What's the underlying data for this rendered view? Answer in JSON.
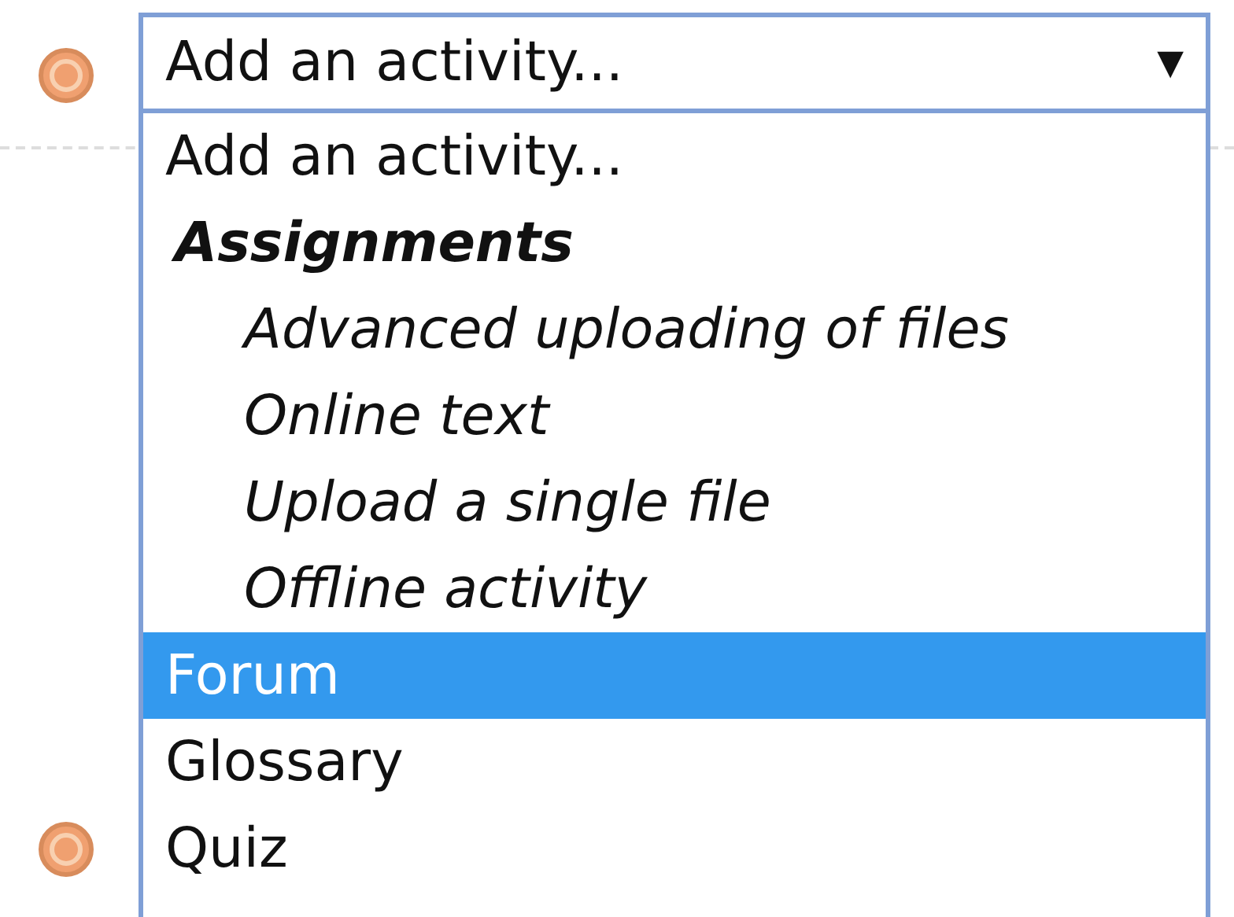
{
  "select": {
    "value": "Add an activity...",
    "arrow": "▼"
  },
  "options": [
    {
      "kind": "option",
      "label": "Add an activity...",
      "selected": false
    },
    {
      "kind": "group",
      "label": "Assignments",
      "children": [
        {
          "label": "Advanced uploading of files",
          "selected": false
        },
        {
          "label": "Online text",
          "selected": false
        },
        {
          "label": "Upload a single file",
          "selected": false
        },
        {
          "label": "Offline activity",
          "selected": false
        }
      ]
    },
    {
      "kind": "option",
      "label": "Forum",
      "selected": true
    },
    {
      "kind": "option",
      "label": "Glossary",
      "selected": false
    },
    {
      "kind": "option",
      "label": "Quiz",
      "selected": false
    }
  ]
}
